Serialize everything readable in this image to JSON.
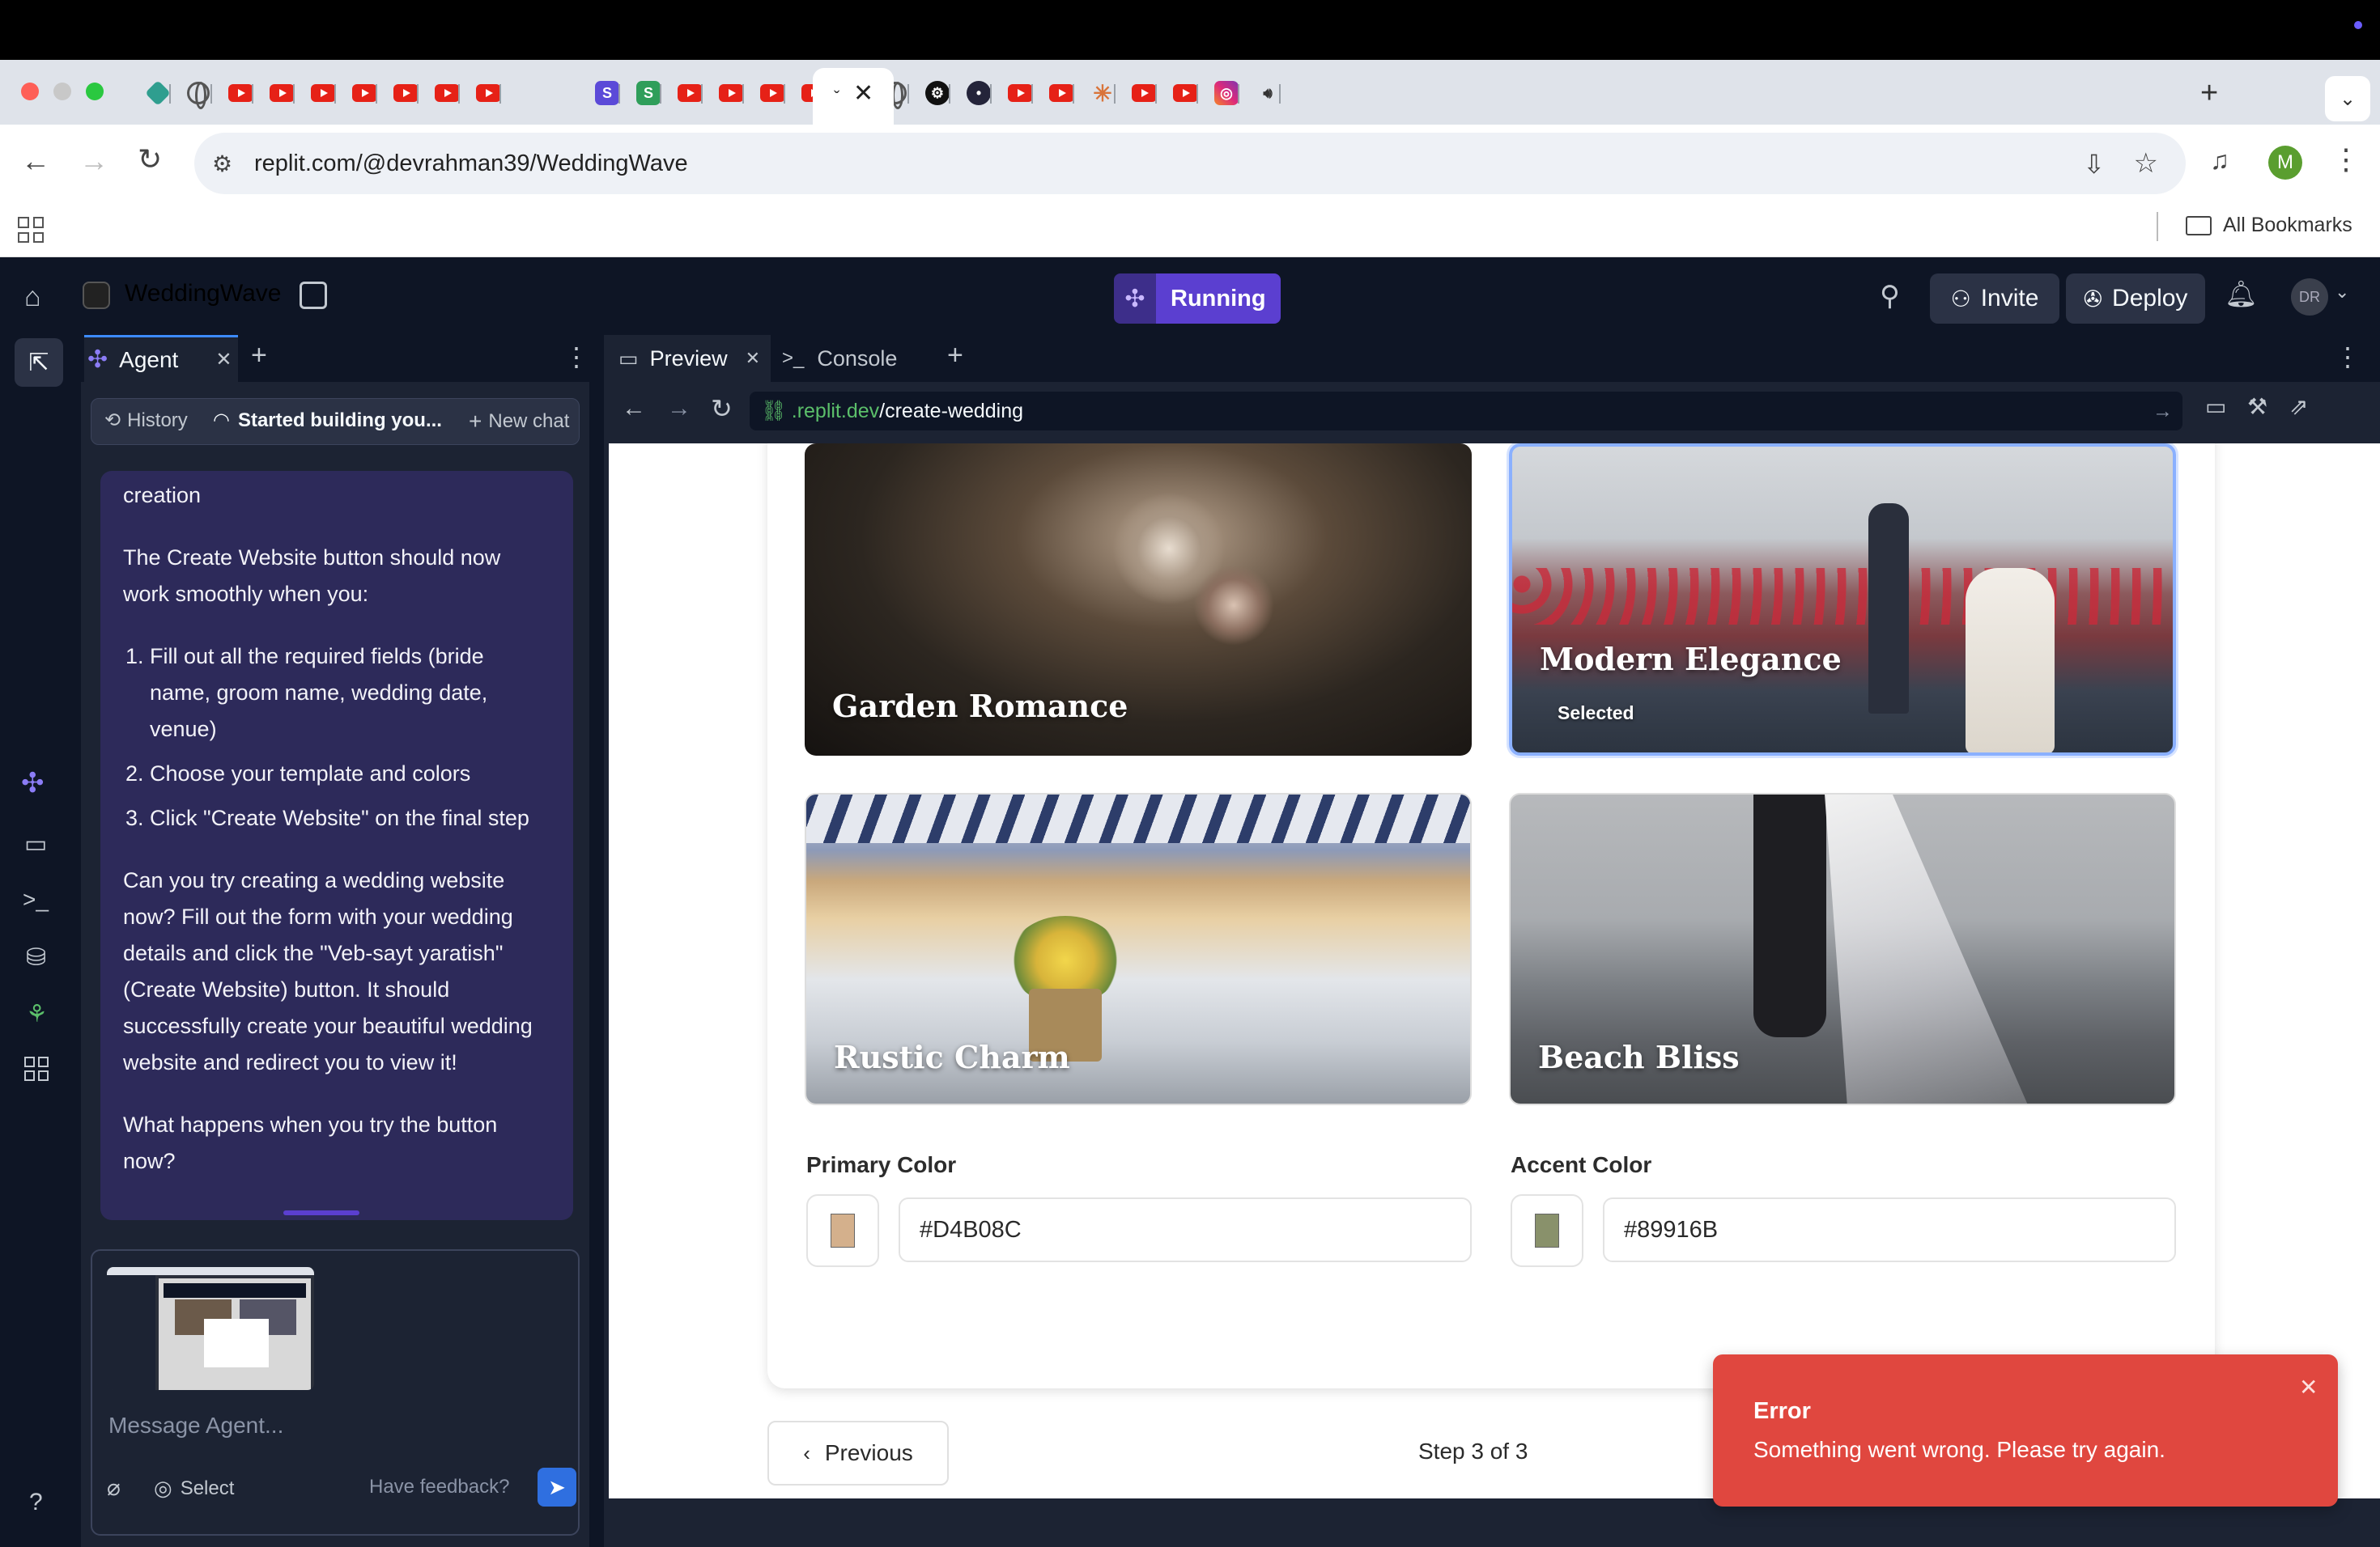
{
  "browser": {
    "url": "replit.com/@devrahman39/WeddingWave",
    "bookmarks_label": "All Bookmarks",
    "profile_initial": "M"
  },
  "header": {
    "project_name": "WeddingWave",
    "run_status": "Running",
    "invite_label": "Invite",
    "deploy_label": "Deploy",
    "avatar_initials": "DR"
  },
  "agent": {
    "tab_label": "Agent",
    "history_label": "History",
    "current_chat_label": "Started building you...",
    "new_chat_label": "New chat",
    "message": {
      "line0": "creation",
      "p1": "The Create Website button should now work smoothly when you:",
      "list": [
        "Fill out all the required fields (bride name, groom name, wedding date, venue)",
        "Choose your template and colors",
        "Click \"Create Website\" on the final step"
      ],
      "p2": "Can you try creating a wedding website now? Fill out the form with your wedding details and click the \"Veb-sayt yaratish\" (Create Website) button. It should successfully create your beautiful wedding website and redirect you to view it!",
      "p3": "What happens when you try the button now?"
    },
    "input_placeholder": "Message Agent...",
    "select_label": "Select",
    "feedback_label": "Have feedback?"
  },
  "preview": {
    "tab_preview": "Preview",
    "tab_console": "Console",
    "url_domain": ".replit.dev",
    "url_path": "/create-wedding",
    "templates": [
      {
        "name": "Garden Romance",
        "selected": false
      },
      {
        "name": "Modern Elegance",
        "selected": true,
        "badge": "Selected"
      },
      {
        "name": "Rustic Charm",
        "selected": false
      },
      {
        "name": "Beach Bliss",
        "selected": false
      }
    ],
    "primary_color_label": "Primary Color",
    "primary_color_value": "#D4B08C",
    "accent_color_label": "Accent Color",
    "accent_color_value": "#89916B",
    "previous_label": "Previous",
    "step_label": "Step 3 of 3",
    "toast_title": "Error",
    "toast_message": "Something went wrong. Please try again."
  },
  "colors": {
    "primary_swatch": "#D4B08C",
    "accent_swatch": "#89916B",
    "toast_bg": "#E0473F",
    "running_bg": "#5b3fd0"
  }
}
